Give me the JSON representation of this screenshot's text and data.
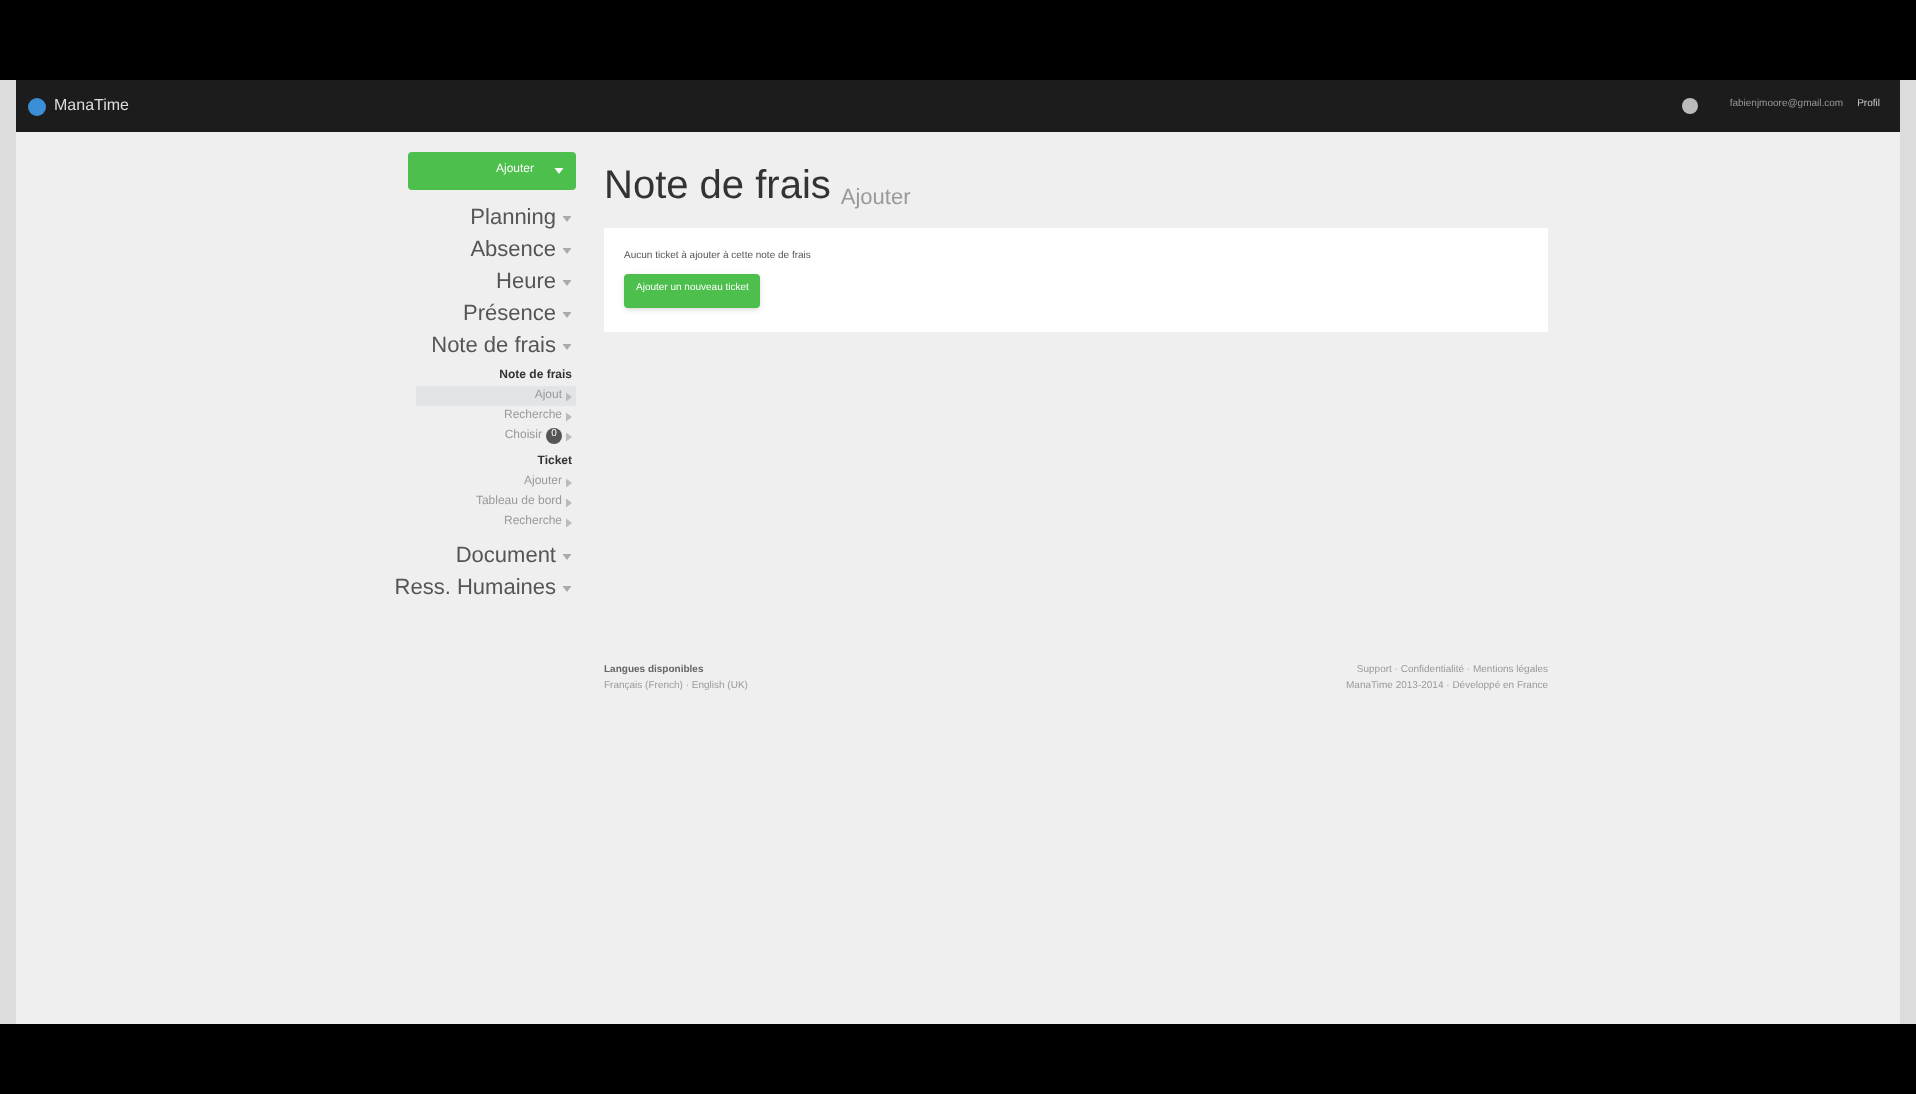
{
  "navbar": {
    "brand": "ManaTime",
    "user": "fabienjmoore@gmail.com",
    "profile": "Profil"
  },
  "sidebar": {
    "add_button": "Ajouter",
    "items": [
      {
        "label": "Planning"
      },
      {
        "label": "Absence"
      },
      {
        "label": "Heure"
      },
      {
        "label": "Présence"
      },
      {
        "label": "Note de frais",
        "children": [
          {
            "label": "Note de frais",
            "kind": "heading"
          },
          {
            "label": "Ajout",
            "kind": "link",
            "selected": true
          },
          {
            "label": "Recherche",
            "kind": "link",
            "selected": false
          },
          {
            "label": "Choisir",
            "kind": "link",
            "selected": false,
            "badge": "0"
          },
          {
            "label": "Ticket",
            "kind": "heading"
          },
          {
            "label": "Ajouter",
            "kind": "link",
            "selected": false
          },
          {
            "label": "Tableau de bord",
            "kind": "link",
            "selected": false
          },
          {
            "label": "Recherche",
            "kind": "link",
            "selected": false
          }
        ]
      },
      {
        "label": "Document"
      },
      {
        "label": "Ress. Humaines"
      }
    ]
  },
  "main": {
    "title": "Note de frais",
    "subtitle": "Ajouter",
    "message": "Aucun ticket à ajouter à cette note de frais",
    "add_ticket_button": "Ajouter un nouveau ticket"
  },
  "footer": {
    "languages_title": "Langues disponibles",
    "languages": "Français (French) · English (UK)",
    "links": "Support · Confidentialité · Mentions légales",
    "copyright": "ManaTime 2013-2014 · Développé en France"
  }
}
